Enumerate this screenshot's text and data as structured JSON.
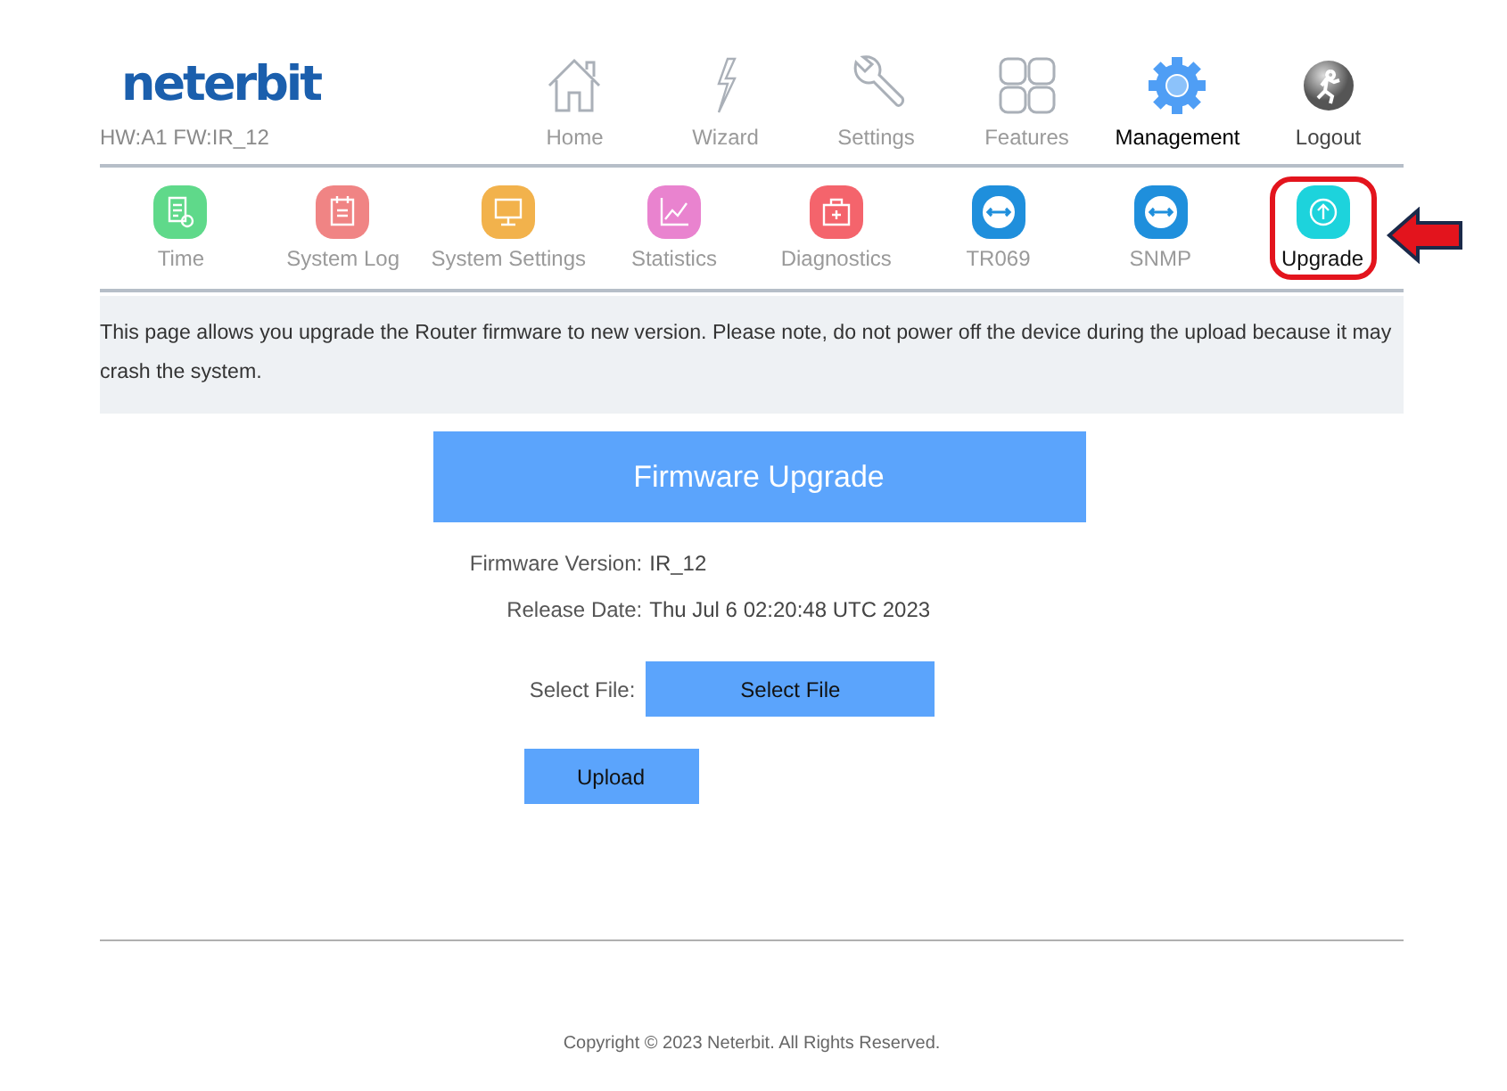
{
  "brand": {
    "logo": "neterbit",
    "version": "HW:A1 FW:IR_12"
  },
  "top_nav": [
    {
      "label": "Home",
      "kind": "home",
      "selected": false
    },
    {
      "label": "Wizard",
      "kind": "wizard",
      "selected": false
    },
    {
      "label": "Settings",
      "kind": "settings",
      "selected": false
    },
    {
      "label": "Features",
      "kind": "features",
      "selected": false
    },
    {
      "label": "Management",
      "kind": "management",
      "selected": true
    },
    {
      "label": "Logout",
      "kind": "logout",
      "selected": false
    }
  ],
  "sub_nav": [
    {
      "label": "Time",
      "kind": "time",
      "color": "#5fd98a",
      "selected": false,
      "highlighted": false
    },
    {
      "label": "System Log",
      "kind": "log",
      "color": "#f08484",
      "selected": false,
      "highlighted": false
    },
    {
      "label": "System Settings",
      "kind": "monitor",
      "color": "#f2b24c",
      "selected": false,
      "highlighted": false
    },
    {
      "label": "Statistics",
      "kind": "chart",
      "color": "#e983cf",
      "selected": false,
      "highlighted": false
    },
    {
      "label": "Diagnostics",
      "kind": "kit",
      "color": "#f4646c",
      "selected": false,
      "highlighted": false
    },
    {
      "label": "TR069",
      "kind": "arrows",
      "color": "#1f8fdc",
      "selected": false,
      "highlighted": false
    },
    {
      "label": "SNMP",
      "kind": "arrows",
      "color": "#1f8fdc",
      "selected": false,
      "highlighted": false
    },
    {
      "label": "Upgrade",
      "kind": "upgrade",
      "color": "#1dd3dc",
      "selected": true,
      "highlighted": true
    }
  ],
  "description": "This page allows you upgrade the Router firmware to new version. Please note, do not power off the device during the upload because it may crash the system.",
  "panel": {
    "title": "Firmware Upgrade",
    "info": [
      {
        "label": "Firmware Version:",
        "value": "IR_12"
      },
      {
        "label": "Release Date:",
        "value": "Thu Jul 6 02:20:48 UTC 2023"
      }
    ],
    "file_label": "Select File:",
    "file_button": "Select File",
    "upload_button": "Upload"
  },
  "footer": "Copyright © 2023 Neterbit. All Rights Reserved."
}
